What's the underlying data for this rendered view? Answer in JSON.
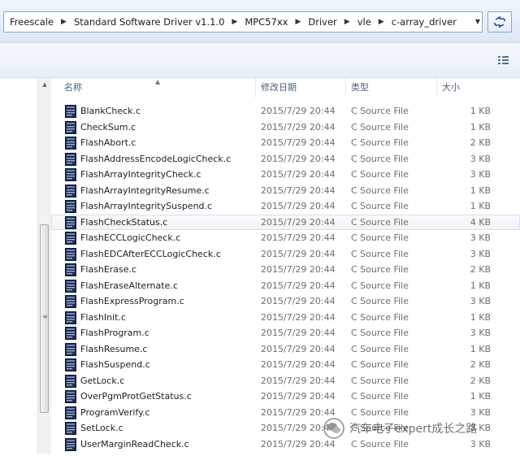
{
  "breadcrumbs": [
    "Freescale",
    "Standard Software Driver v1.1.0",
    "MPC57xx",
    "Driver",
    "vle",
    "c-array_driver"
  ],
  "columns": {
    "name": "名称",
    "modified": "修改日期",
    "type": "类型",
    "size": "大小"
  },
  "files": [
    {
      "name": "BlankCheck.c",
      "modified": "2015/7/29 20:44",
      "type": "C Source File",
      "size": "1 KB"
    },
    {
      "name": "CheckSum.c",
      "modified": "2015/7/29 20:44",
      "type": "C Source File",
      "size": "1 KB"
    },
    {
      "name": "FlashAbort.c",
      "modified": "2015/7/29 20:44",
      "type": "C Source File",
      "size": "2 KB"
    },
    {
      "name": "FlashAddressEncodeLogicCheck.c",
      "modified": "2015/7/29 20:44",
      "type": "C Source File",
      "size": "3 KB"
    },
    {
      "name": "FlashArrayIntegrityCheck.c",
      "modified": "2015/7/29 20:44",
      "type": "C Source File",
      "size": "3 KB"
    },
    {
      "name": "FlashArrayIntegrityResume.c",
      "modified": "2015/7/29 20:44",
      "type": "C Source File",
      "size": "1 KB"
    },
    {
      "name": "FlashArrayIntegritySuspend.c",
      "modified": "2015/7/29 20:44",
      "type": "C Source File",
      "size": "1 KB"
    },
    {
      "name": "FlashCheckStatus.c",
      "modified": "2015/7/29 20:44",
      "type": "C Source File",
      "size": "4 KB"
    },
    {
      "name": "FlashECCLogicCheck.c",
      "modified": "2015/7/29 20:44",
      "type": "C Source File",
      "size": "3 KB"
    },
    {
      "name": "FlashEDCAfterECCLogicCheck.c",
      "modified": "2015/7/29 20:44",
      "type": "C Source File",
      "size": "3 KB"
    },
    {
      "name": "FlashErase.c",
      "modified": "2015/7/29 20:44",
      "type": "C Source File",
      "size": "2 KB"
    },
    {
      "name": "FlashEraseAlternate.c",
      "modified": "2015/7/29 20:44",
      "type": "C Source File",
      "size": "1 KB"
    },
    {
      "name": "FlashExpressProgram.c",
      "modified": "2015/7/29 20:44",
      "type": "C Source File",
      "size": "3 KB"
    },
    {
      "name": "FlashInit.c",
      "modified": "2015/7/29 20:44",
      "type": "C Source File",
      "size": "1 KB"
    },
    {
      "name": "FlashProgram.c",
      "modified": "2015/7/29 20:44",
      "type": "C Source File",
      "size": "3 KB"
    },
    {
      "name": "FlashResume.c",
      "modified": "2015/7/29 20:44",
      "type": "C Source File",
      "size": "1 KB"
    },
    {
      "name": "FlashSuspend.c",
      "modified": "2015/7/29 20:44",
      "type": "C Source File",
      "size": "2 KB"
    },
    {
      "name": "GetLock.c",
      "modified": "2015/7/29 20:44",
      "type": "C Source File",
      "size": "2 KB"
    },
    {
      "name": "OverPgmProtGetStatus.c",
      "modified": "2015/7/29 20:44",
      "type": "C Source File",
      "size": "1 KB"
    },
    {
      "name": "ProgramVerify.c",
      "modified": "2015/7/29 20:44",
      "type": "C Source File",
      "size": "3 KB"
    },
    {
      "name": "SetLock.c",
      "modified": "2015/7/29 20:44",
      "type": "C Source File",
      "size": "3 KB"
    },
    {
      "name": "UserMarginReadCheck.c",
      "modified": "2015/7/29 20:44",
      "type": "C Source File",
      "size": "3 KB"
    }
  ],
  "highlighted_row": 7,
  "watermark": {
    "text": "汽车电子expert成长之路"
  },
  "icons": {
    "separator": "chevron-right-icon",
    "history": "chevron-down-icon",
    "refresh": "refresh-icon",
    "views": "view-options-icon",
    "file": "c-source-file-icon",
    "watermark": "wechat-logo-icon"
  },
  "colors": {
    "accent": "#1a4aa0",
    "header_text": "#4c607a",
    "meta_text": "#6d6d6d"
  }
}
